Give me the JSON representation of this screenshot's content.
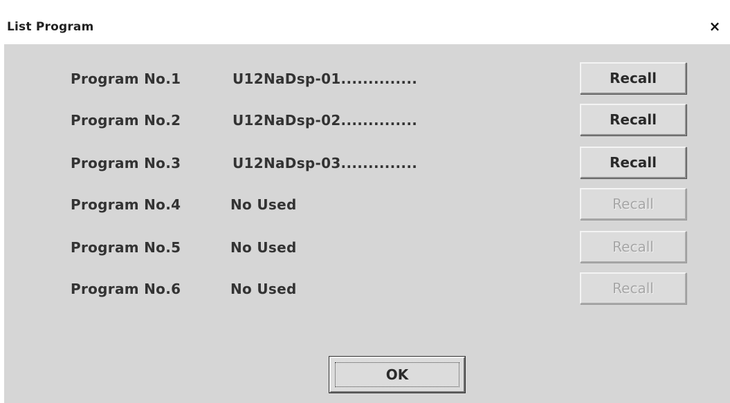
{
  "dialog": {
    "title": "List Program",
    "close_glyph": "×",
    "ok_label": "OK"
  },
  "programs": [
    {
      "label": "Program No.1",
      "name": "U12NaDsp-01..............",
      "recall_label": "Recall",
      "recall_enabled": true
    },
    {
      "label": "Program No.2",
      "name": "U12NaDsp-02..............",
      "recall_label": "Recall",
      "recall_enabled": true
    },
    {
      "label": "Program No.3",
      "name": "U12NaDsp-03..............",
      "recall_label": "Recall",
      "recall_enabled": true
    },
    {
      "label": "Program No.4",
      "name": "No Used",
      "recall_label": "Recall",
      "recall_enabled": false
    },
    {
      "label": "Program No.5",
      "name": "No Used",
      "recall_label": "Recall",
      "recall_enabled": false
    },
    {
      "label": "Program No.6",
      "name": "No Used",
      "recall_label": "Recall",
      "recall_enabled": false
    }
  ]
}
